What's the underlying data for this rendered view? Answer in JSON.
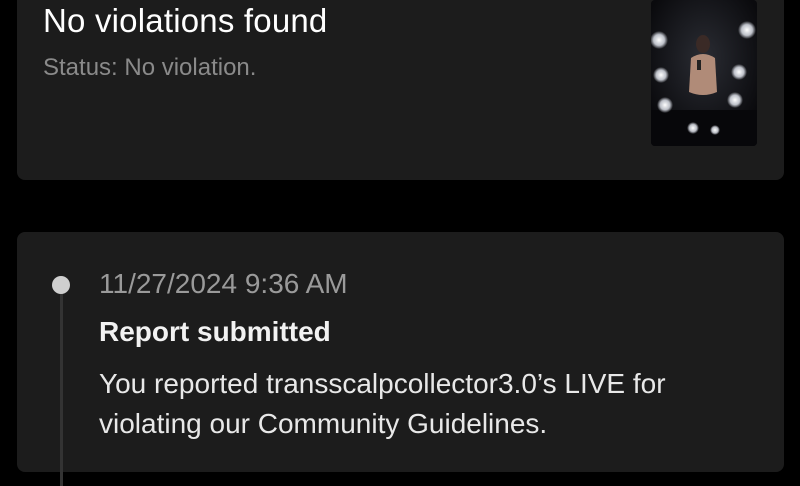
{
  "result": {
    "title": "No violations found",
    "status": "Status: No violation.",
    "thumbnail_icon": "video-thumbnail"
  },
  "history": {
    "events": [
      {
        "time": "11/27/2024 9:36 AM",
        "title": "Report submitted",
        "description": "You reported transscalpcollector3.0’s LIVE for violating our Community Guidelines."
      }
    ]
  },
  "colors": {
    "background": "#000000",
    "card": "#1c1c1c",
    "text_primary": "#ffffff",
    "text_secondary": "#8a8a8a",
    "timeline_dot": "#cfcfcf"
  }
}
